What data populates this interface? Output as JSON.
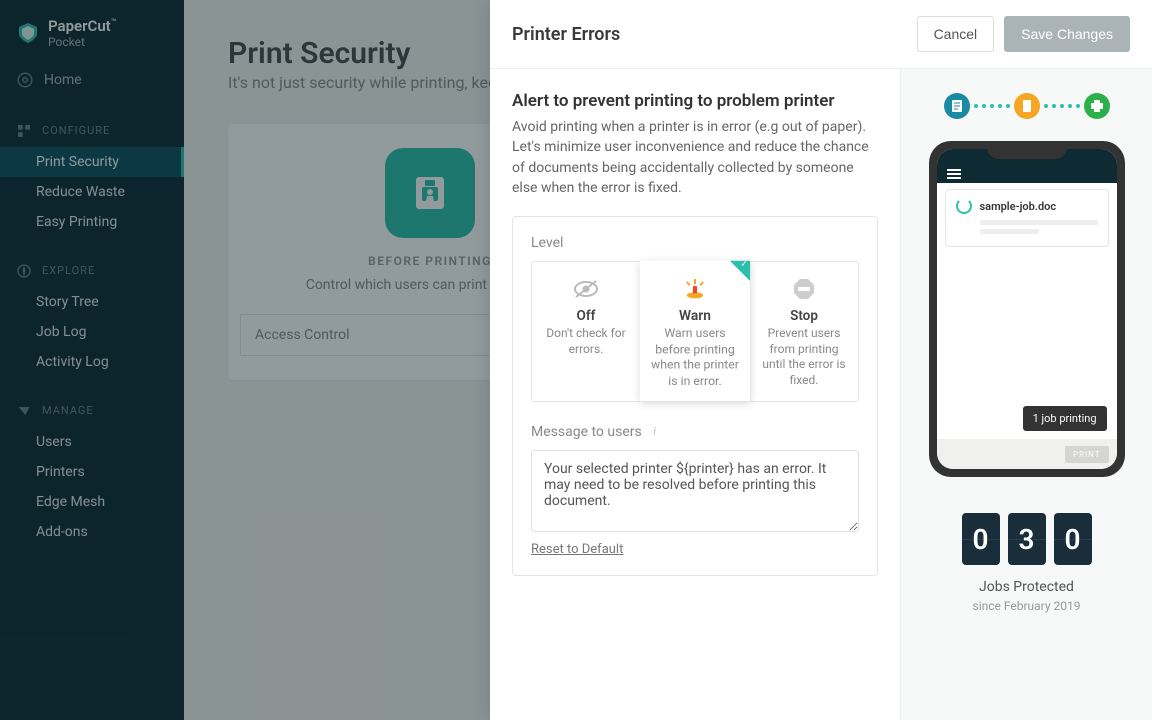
{
  "brand": {
    "name": "PaperCut",
    "sub": "Pocket"
  },
  "sidebar": {
    "home": "Home",
    "configure": {
      "label": "CONFIGURE",
      "items": [
        "Print Security",
        "Reduce Waste",
        "Easy Printing"
      ]
    },
    "explore": {
      "label": "EXPLORE",
      "items": [
        "Story Tree",
        "Job Log",
        "Activity Log"
      ]
    },
    "manage": {
      "label": "MANAGE",
      "items": [
        "Users",
        "Printers",
        "Edge Mesh",
        "Add-ons"
      ]
    }
  },
  "page": {
    "title": "Print Security",
    "subtitle": "It's not just security while printing, keep your data secure."
  },
  "card": {
    "label": "BEFORE PRINTING",
    "desc": "Control which users can print and when.",
    "row": "Access Control"
  },
  "panel": {
    "title": "Printer Errors",
    "cancel": "Cancel",
    "save": "Save Changes",
    "alert_heading": "Alert to prevent printing to problem printer",
    "alert_desc": "Avoid printing when a printer is in error (e.g out of paper). Let's minimize user inconvenience and reduce the chance of documents being accidentally collected by someone else when the error is fixed.",
    "level_label": "Level",
    "levels": [
      {
        "title": "Off",
        "desc": "Don't check for errors."
      },
      {
        "title": "Warn",
        "desc": "Warn users before printing when the printer is in error."
      },
      {
        "title": "Stop",
        "desc": "Prevent users from printing until the error is fixed."
      }
    ],
    "msg_label": "Message to users",
    "msg_value": "Your selected printer ${printer} has an error. It may need to be resolved before printing this document.",
    "reset": "Reset to Default"
  },
  "preview": {
    "filename": "sample-job.doc",
    "toast": "1 job printing",
    "print_btn": "PRINT",
    "counter": [
      "0",
      "3",
      "0"
    ],
    "counter_label": "Jobs Protected",
    "counter_sub": "since February 2019"
  }
}
